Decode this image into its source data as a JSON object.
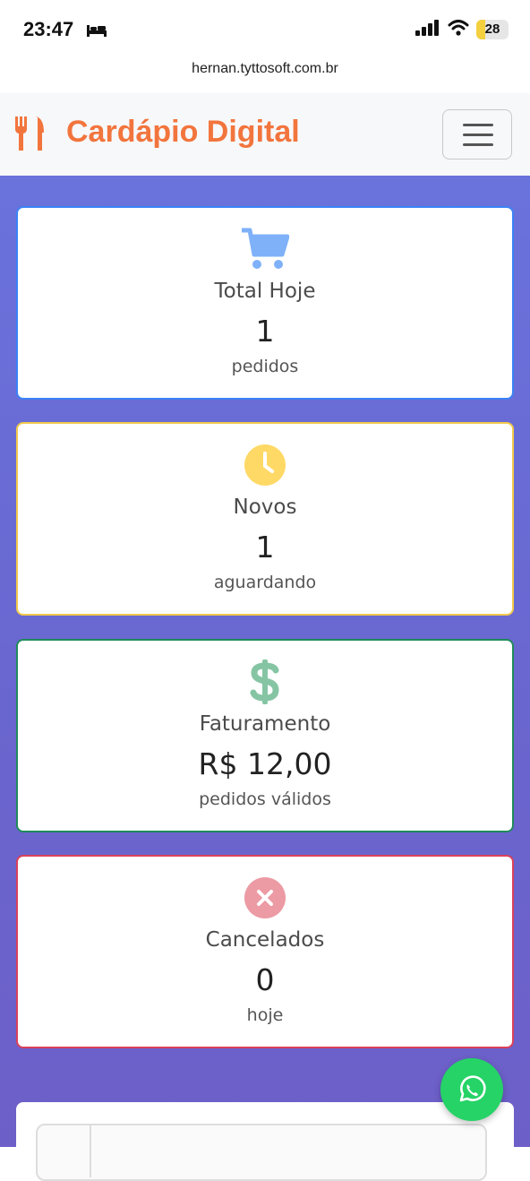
{
  "status_bar": {
    "time": "23:47",
    "battery": "28",
    "battery_level": 0.28
  },
  "browser": {
    "url": "hernan.tyttosoft.com.br"
  },
  "navbar": {
    "brand": "Cardápio Digital",
    "brand_icon": "utensils-icon",
    "menu_icon": "hamburger-icon"
  },
  "cards": [
    {
      "title": "Total Hoje",
      "value": "1",
      "sub": "pedidos",
      "icon": "cart-icon",
      "color": "#0d6efd"
    },
    {
      "title": "Novos",
      "value": "1",
      "sub": "aguardando",
      "icon": "clock-icon",
      "color": "#ffc107"
    },
    {
      "title": "Faturamento",
      "value": "R$ 12,00",
      "sub": "pedidos válidos",
      "icon": "dollar-icon",
      "color": "#198754"
    },
    {
      "title": "Cancelados",
      "value": "0",
      "sub": "hoje",
      "icon": "x-circle-icon",
      "color": "#dc3545"
    }
  ],
  "colors": {
    "brand": "#f2753d",
    "background_gradient": [
      "#6a72dc",
      "#6d5fc8"
    ],
    "whatsapp": "#25d366"
  },
  "fab": {
    "icon": "whatsapp-icon"
  }
}
